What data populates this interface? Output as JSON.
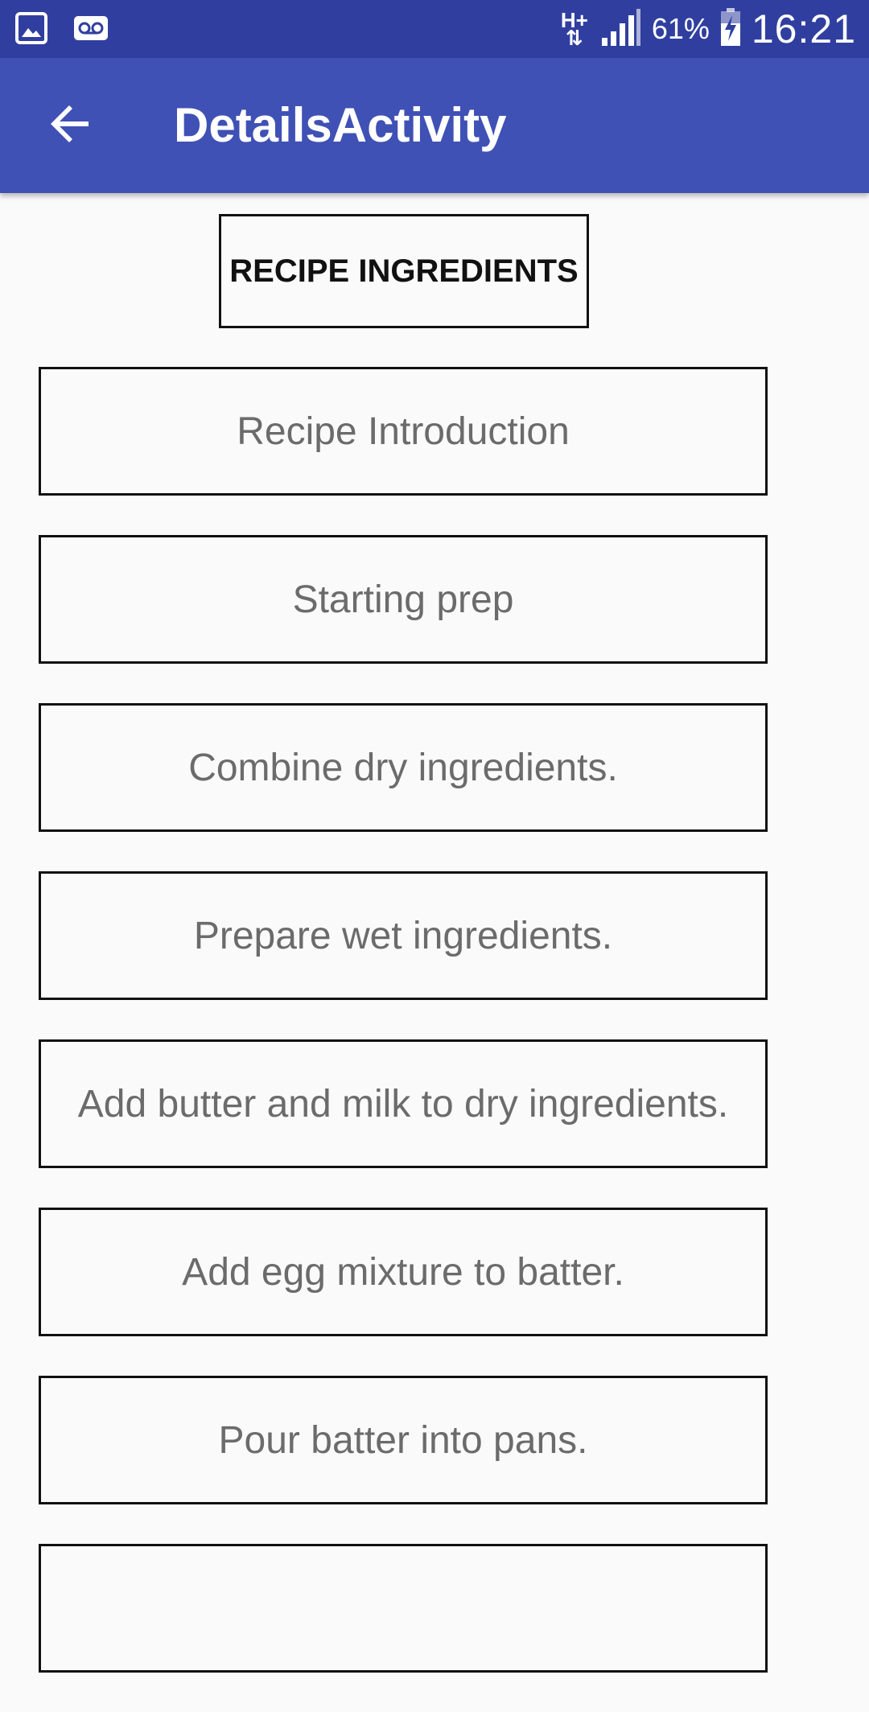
{
  "status_bar": {
    "network_type": "H+",
    "battery_percent": "61%",
    "time": "16:21",
    "icons": [
      "image-icon",
      "voicemail-icon",
      "data-arrows-icon",
      "signal-icon",
      "battery-charging-icon"
    ]
  },
  "app_bar": {
    "title": "DetailsActivity",
    "back_icon": "arrow-back-icon"
  },
  "main": {
    "ingredients_button": "RECIPE INGREDIENTS",
    "steps": [
      {
        "label": "Recipe Introduction"
      },
      {
        "label": "Starting prep"
      },
      {
        "label": "Combine dry ingredients."
      },
      {
        "label": "Prepare wet ingredients."
      },
      {
        "label": "Add butter and milk to dry ingredients."
      },
      {
        "label": "Add egg mixture to batter."
      },
      {
        "label": "Pour batter into pans."
      },
      {
        "label": ""
      }
    ]
  },
  "colors": {
    "status_bar": "#303f9f",
    "app_bar": "#3f51b5",
    "background": "#fafafa",
    "border": "#111111",
    "step_text": "#6b6b6b"
  }
}
